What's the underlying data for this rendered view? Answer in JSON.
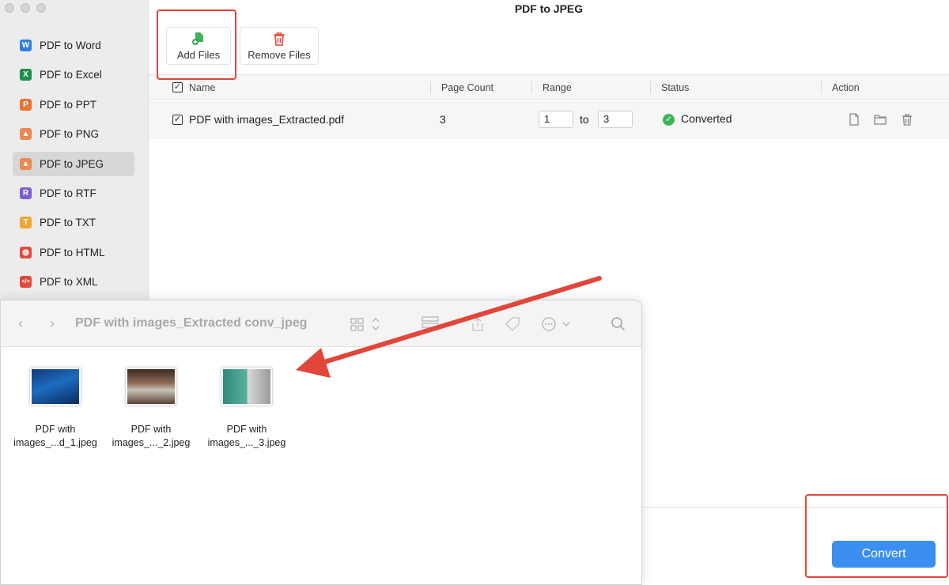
{
  "window": {
    "title": "PDF to JPEG"
  },
  "sidebar": {
    "items": [
      {
        "label": "PDF to Word",
        "icon": "W",
        "color": "#2f7fe0"
      },
      {
        "label": "PDF to Excel",
        "icon": "X",
        "color": "#1f8f4e"
      },
      {
        "label": "PDF to PPT",
        "icon": "P",
        "color": "#e87433"
      },
      {
        "label": "PDF to PNG",
        "icon": "▲",
        "color": "#e88a52"
      },
      {
        "label": "PDF to JPEG",
        "icon": "▲",
        "color": "#e88a52",
        "active": true
      },
      {
        "label": "PDF to RTF",
        "icon": "R",
        "color": "#7c5fd0"
      },
      {
        "label": "PDF to TXT",
        "icon": "T",
        "color": "#f0a634"
      },
      {
        "label": "PDF to HTML",
        "icon": "◍",
        "color": "#e04b3f"
      },
      {
        "label": "PDF to XML",
        "icon": "</>",
        "color": "#e04b3f"
      }
    ]
  },
  "toolbar": {
    "add_label": "Add Files",
    "remove_label": "Remove Files"
  },
  "table": {
    "headers": {
      "name": "Name",
      "page_count": "Page Count",
      "range": "Range",
      "status": "Status",
      "action": "Action"
    },
    "row": {
      "name": "PDF with images_Extracted.pdf",
      "page_count": "3",
      "range_from": "1",
      "range_to_label": "to",
      "range_to": "3",
      "status": "Converted"
    }
  },
  "convert_label": "Convert",
  "finder": {
    "title": "PDF with images_Extracted conv_jpeg",
    "files": [
      {
        "line1": "PDF with",
        "line2": "images_...d_1.jpeg"
      },
      {
        "line1": "PDF with",
        "line2": "images_..._2.jpeg"
      },
      {
        "line1": "PDF with",
        "line2": "images_..._3.jpeg"
      }
    ]
  },
  "colors": {
    "accent": "#3a8ff0",
    "highlight": "#e0463a",
    "success": "#3eb35a"
  }
}
